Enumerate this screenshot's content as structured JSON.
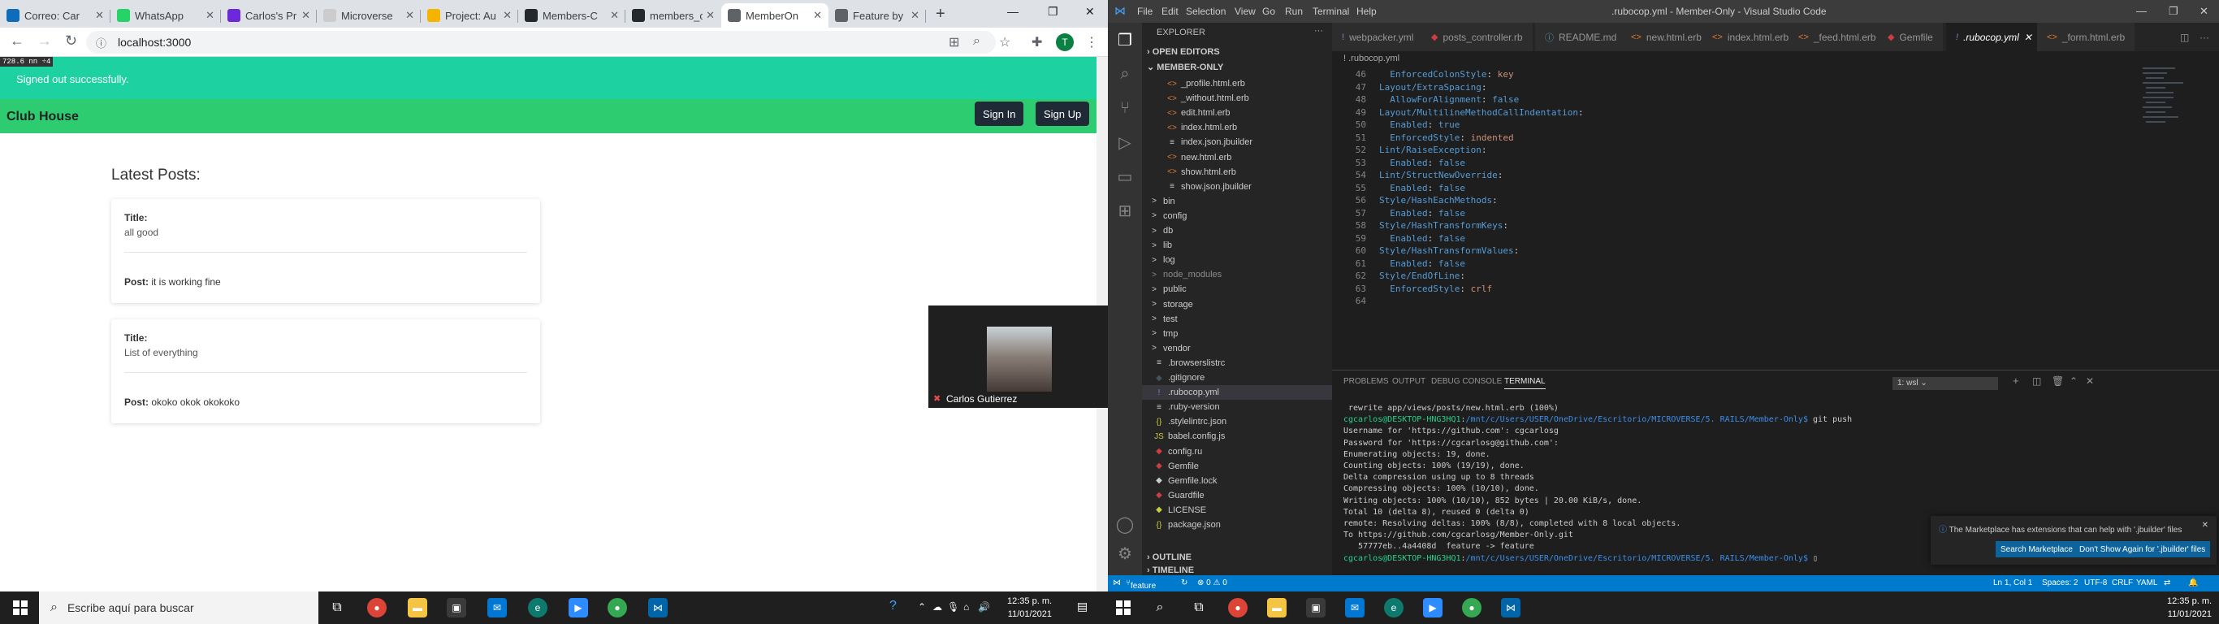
{
  "browser": {
    "tabs": [
      {
        "label": "Correo: Car",
        "icon": "outlook-icon",
        "color": "#0f6cbd"
      },
      {
        "label": "WhatsApp",
        "icon": "whatsapp-icon",
        "color": "#25d366"
      },
      {
        "label": "Carlos's Pr",
        "icon": "microverse-icon",
        "color": "#6d28d9"
      },
      {
        "label": "Microverse",
        "icon": "page-icon",
        "color": "#cccccc"
      },
      {
        "label": "Project: Au",
        "icon": "project-icon",
        "color": "#f4b400"
      },
      {
        "label": "Members-C",
        "icon": "github-icon",
        "color": "#24292e"
      },
      {
        "label": "members_c",
        "icon": "github-icon",
        "color": "#24292e"
      },
      {
        "label": "MemberOn",
        "icon": "globe-icon",
        "color": "#5f6368"
      },
      {
        "label": "Feature by",
        "icon": "globe-icon",
        "color": "#5f6368"
      }
    ],
    "url": "localhost:3000"
  },
  "page": {
    "dims_badge": "728.6 nn ÷4",
    "notice": "Signed out successfully.",
    "brand": "Club House",
    "sign_in": "Sign In",
    "sign_up": "Sign Up",
    "heading": "Latest Posts:",
    "title_label": "Title:",
    "post_label": "Post:",
    "posts": [
      {
        "title": "all good",
        "post": "it is working fine"
      },
      {
        "title": "List of everything",
        "post": "okoko okok okokoko"
      }
    ],
    "video_name": "Carlos Gutierrez"
  },
  "taskbar_left": {
    "search_placeholder": "Escribe aquí para buscar",
    "time": "12:35 p. m.",
    "date": "11/01/2021"
  },
  "taskbar_right": {
    "time": "12:35 p. m.",
    "date": "11/01/2021"
  },
  "vscode": {
    "menu": [
      "File",
      "Edit",
      "Selection",
      "View",
      "Go",
      "Run",
      "Terminal",
      "Help"
    ],
    "window_title": ".rubocop.yml - Member-Only - Visual Studio Code",
    "explorer_title": "EXPLORER",
    "open_editors": "OPEN EDITORS",
    "member_only": "MEMBER-ONLY",
    "outline": "OUTLINE",
    "timeline": "TIMELINE",
    "files": [
      {
        "name": "_profile.html.erb",
        "icon": "<>",
        "color": "#e37933"
      },
      {
        "name": "_without.html.erb",
        "icon": "<>",
        "color": "#e37933"
      },
      {
        "name": "edit.html.erb",
        "icon": "<>",
        "color": "#e37933"
      },
      {
        "name": "index.html.erb",
        "icon": "<>",
        "color": "#e37933"
      },
      {
        "name": "index.json.jbuilder",
        "icon": "≡",
        "color": "#cccccc"
      },
      {
        "name": "new.html.erb",
        "icon": "<>",
        "color": "#e37933"
      },
      {
        "name": "show.html.erb",
        "icon": "<>",
        "color": "#e37933"
      },
      {
        "name": "show.json.jbuilder",
        "icon": "≡",
        "color": "#cccccc"
      },
      {
        "name": "bin",
        "icon": ">",
        "color": "#cccccc"
      },
      {
        "name": "config",
        "icon": ">",
        "color": "#cccccc"
      },
      {
        "name": "db",
        "icon": ">",
        "color": "#cccccc"
      },
      {
        "name": "lib",
        "icon": ">",
        "color": "#cccccc"
      },
      {
        "name": "log",
        "icon": ">",
        "color": "#cccccc"
      },
      {
        "name": "node_modules",
        "icon": ">",
        "color": "#8b8b8b"
      },
      {
        "name": "public",
        "icon": ">",
        "color": "#cccccc"
      },
      {
        "name": "storage",
        "icon": ">",
        "color": "#cccccc"
      },
      {
        "name": "test",
        "icon": ">",
        "color": "#cccccc"
      },
      {
        "name": "tmp",
        "icon": ">",
        "color": "#cccccc"
      },
      {
        "name": "vendor",
        "icon": ">",
        "color": "#cccccc"
      },
      {
        "name": ".browserslistrc",
        "icon": "≡",
        "color": "#cccccc"
      },
      {
        "name": ".gitignore",
        "icon": "◆",
        "color": "#41535b"
      },
      {
        "name": ".rubocop.yml",
        "icon": "!",
        "color": "#a074c4"
      },
      {
        "name": ".ruby-version",
        "icon": "≡",
        "color": "#cccccc"
      },
      {
        "name": ".stylelintrc.json",
        "icon": "{}",
        "color": "#cbcb41"
      },
      {
        "name": "babel.config.js",
        "icon": "JS",
        "color": "#cbcb41"
      },
      {
        "name": "config.ru",
        "icon": "◆",
        "color": "#cc3e44"
      },
      {
        "name": "Gemfile",
        "icon": "◆",
        "color": "#cc3e44"
      },
      {
        "name": "Gemfile.lock",
        "icon": "◆",
        "color": "#cccccc"
      },
      {
        "name": "Guardfile",
        "icon": "◆",
        "color": "#cc3e44"
      },
      {
        "name": "LICENSE",
        "icon": "◆",
        "color": "#cbcb41"
      },
      {
        "name": "package.json",
        "icon": "{}",
        "color": "#cbcb41"
      }
    ],
    "editor_tabs": [
      {
        "label": "webpacker.yml",
        "icon": "!",
        "color": "#a074c4"
      },
      {
        "label": "posts_controller.rb",
        "icon": "◆",
        "color": "#cc3e44"
      },
      {
        "label": "README.md",
        "icon": "ⓘ",
        "color": "#519aba"
      },
      {
        "label": "new.html.erb",
        "icon": "<>",
        "color": "#e37933"
      },
      {
        "label": "index.html.erb",
        "icon": "<>",
        "color": "#e37933"
      },
      {
        "label": "_feed.html.erb",
        "icon": "<>",
        "color": "#e37933"
      },
      {
        "label": "Gemfile",
        "icon": "◆",
        "color": "#cc3e44"
      },
      {
        "label": ".rubocop.yml",
        "icon": "!",
        "color": "#a074c4"
      },
      {
        "label": "_form.html.erb",
        "icon": "<>",
        "color": "#e37933"
      }
    ],
    "breadcrumb": "! .rubocop.yml",
    "code_lines": [
      {
        "n": "46",
        "k": "  EnforcedColonStyle",
        "v": "key"
      },
      {
        "n": "47",
        "k": "Layout/ExtraSpacing",
        "v": ""
      },
      {
        "n": "48",
        "k": "  AllowForAlignment",
        "v": "false"
      },
      {
        "n": "49",
        "k": "Layout/MultilineMethodCallIndentation",
        "v": ""
      },
      {
        "n": "50",
        "k": "  Enabled",
        "v": "true"
      },
      {
        "n": "51",
        "k": "  EnforcedStyle",
        "v": "indented"
      },
      {
        "n": "52",
        "k": "Lint/RaiseException",
        "v": ""
      },
      {
        "n": "53",
        "k": "  Enabled",
        "v": "false"
      },
      {
        "n": "54",
        "k": "Lint/StructNewOverride",
        "v": ""
      },
      {
        "n": "55",
        "k": "  Enabled",
        "v": "false"
      },
      {
        "n": "56",
        "k": "Style/HashEachMethods",
        "v": ""
      },
      {
        "n": "57",
        "k": "  Enabled",
        "v": "false"
      },
      {
        "n": "58",
        "k": "Style/HashTransformKeys",
        "v": ""
      },
      {
        "n": "59",
        "k": "  Enabled",
        "v": "false"
      },
      {
        "n": "60",
        "k": "Style/HashTransformValues",
        "v": ""
      },
      {
        "n": "61",
        "k": "  Enabled",
        "v": "false"
      },
      {
        "n": "62",
        "k": "Style/EndOfLine",
        "v": ""
      },
      {
        "n": "63",
        "k": "  EnforcedStyle",
        "v": "crlf"
      },
      {
        "n": "64",
        "k": "",
        "v": ""
      }
    ],
    "panel_tabs": [
      "PROBLEMS",
      "OUTPUT",
      "DEBUG CONSOLE",
      "TERMINAL"
    ],
    "terminal_select": "1: wsl",
    "terminal_lines": [
      " rewrite app/views/posts/new.html.erb (100%)",
      "cgcarlos@DESKTOP-HNG3HQ1:/mnt/c/Users/USER/OneDrive/Escritorio/MICROVERSE/5. RAILS/Member-Only$ git push",
      "Username for 'https://github.com': cgcarlosg",
      "Password for 'https://cgcarlosg@github.com':",
      "Enumerating objects: 19, done.",
      "Counting objects: 100% (19/19), done.",
      "Delta compression using up to 8 threads",
      "Compressing objects: 100% (10/10), done.",
      "Writing objects: 100% (10/10), 852 bytes | 20.00 KiB/s, done.",
      "Total 10 (delta 8), reused 0 (delta 0)",
      "remote: Resolving deltas: 100% (8/8), completed with 8 local objects.",
      "To https://github.com/cgcarlosg/Member-Only.git",
      "   57777eb..4a4408d  feature -> feature",
      "cgcarlos@DESKTOP-HNG3HQ1:/mnt/c/Users/USER/OneDrive/Escritorio/MICROVERSE/5. RAILS/Member-Only$ "
    ],
    "toast": {
      "message": "The Marketplace has extensions that can help with '.jbuilder' files",
      "btn1": "Search Marketplace",
      "btn2": "Don't Show Again for '.jbuilder' files"
    },
    "status": {
      "branch": "feature",
      "problems": "⊗ 0 ⚠ 0",
      "position": "Ln 1, Col 1",
      "spaces": "Spaces: 2",
      "encoding": "UTF-8",
      "eol": "CRLF",
      "language": "YAML"
    }
  }
}
